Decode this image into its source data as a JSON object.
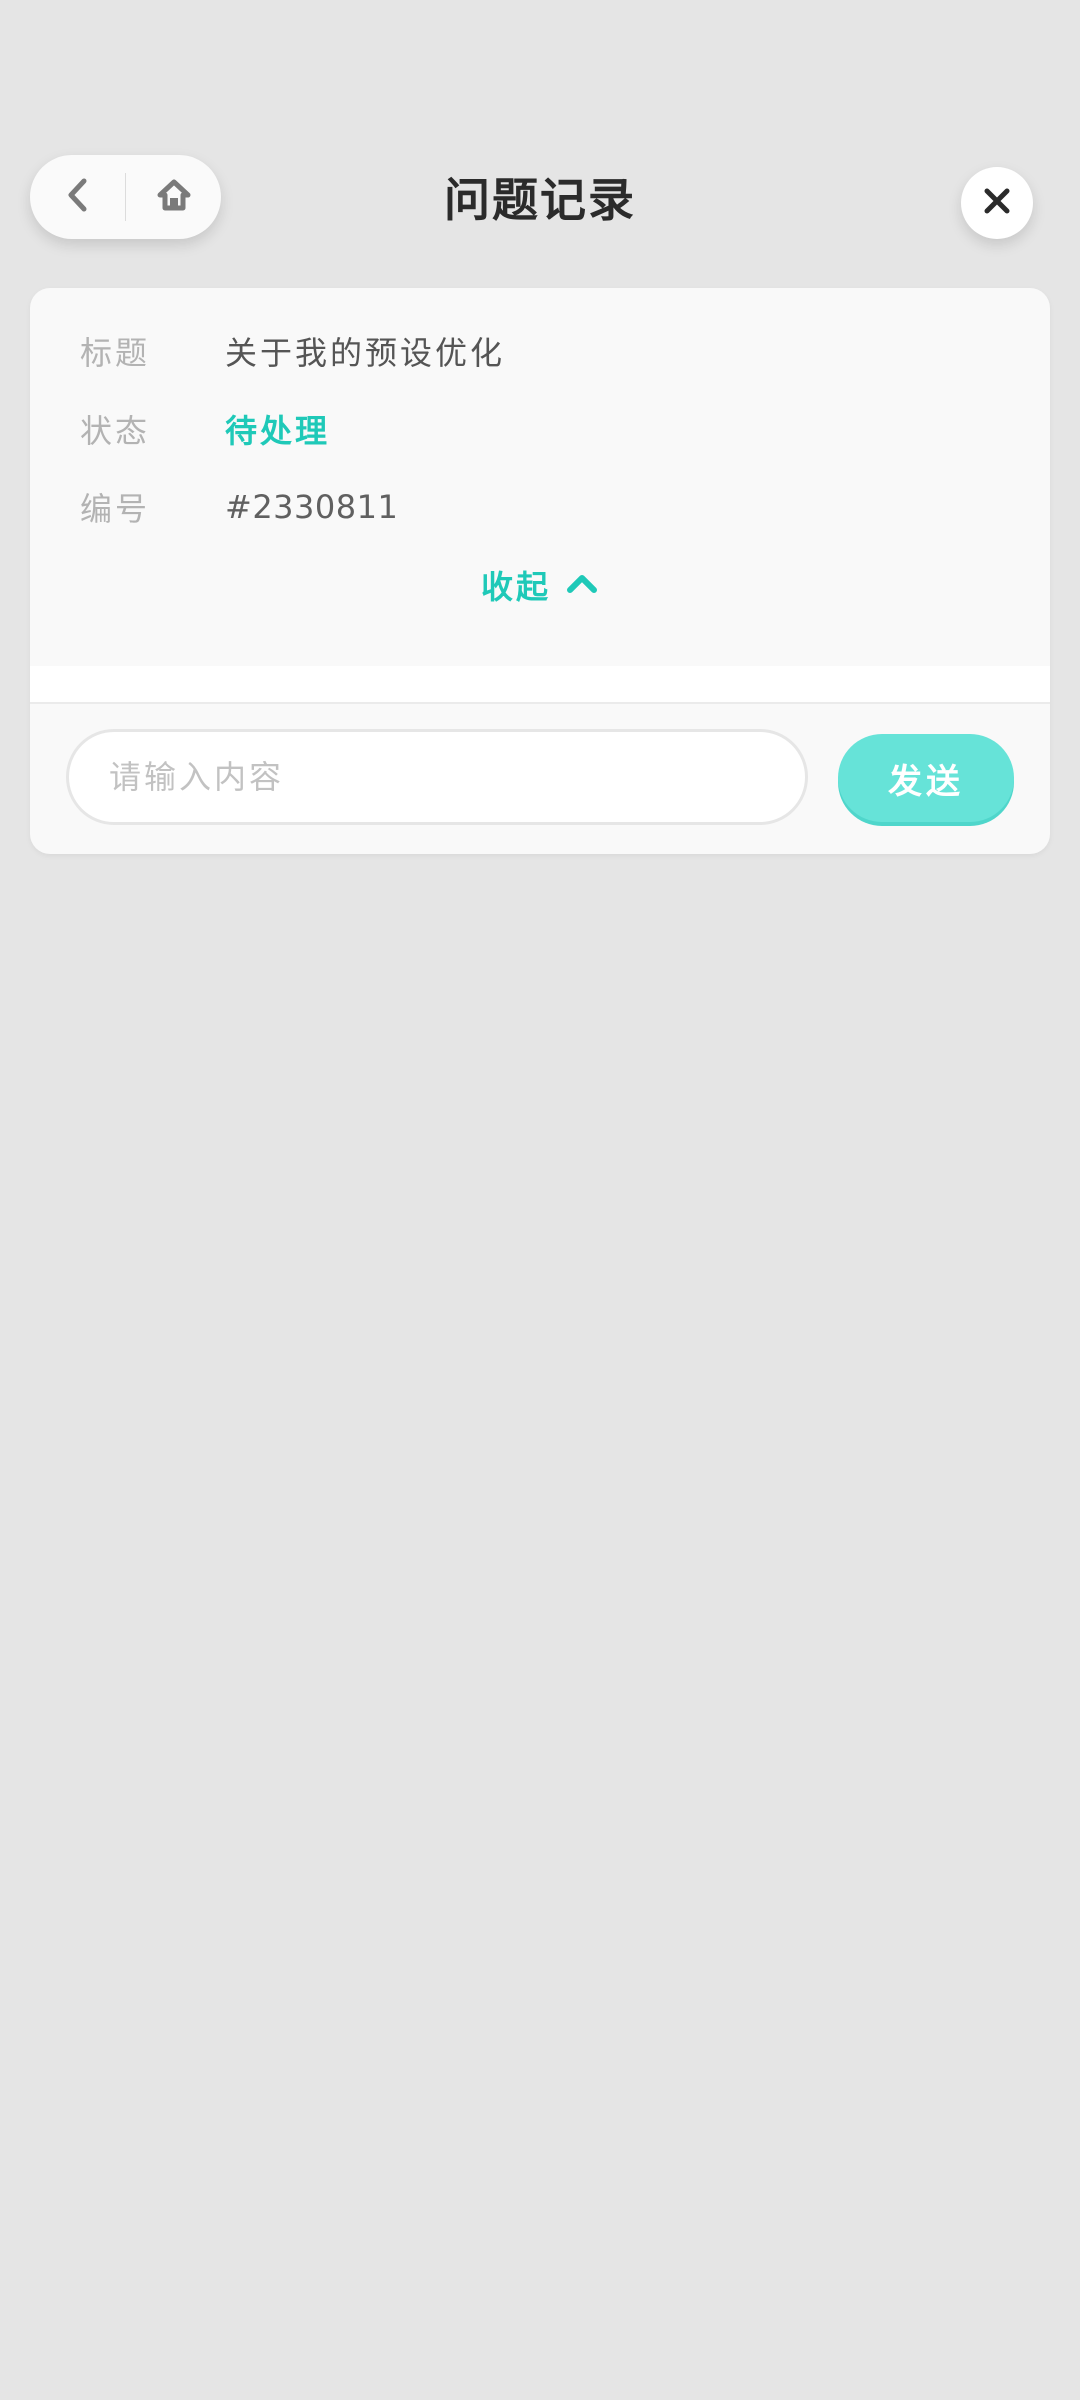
{
  "header": {
    "title": "问题记录",
    "back_icon": "chevron-left-icon",
    "home_icon": "home-icon",
    "close_icon": "close-icon"
  },
  "issue": {
    "fields": [
      {
        "label": "标题",
        "value": "关于我的预设优化"
      },
      {
        "label": "状态",
        "value": "待处理"
      },
      {
        "label": "编号",
        "value": "#2330811"
      }
    ],
    "collapse_label": "收起",
    "collapse_icon": "chevron-up-icon"
  },
  "composer": {
    "placeholder": "请输入内容",
    "value": "",
    "send_label": "发送"
  },
  "colors": {
    "accent": "#1fc9b8",
    "send_button": "#66e3d8",
    "background": "#e5e5e5"
  }
}
